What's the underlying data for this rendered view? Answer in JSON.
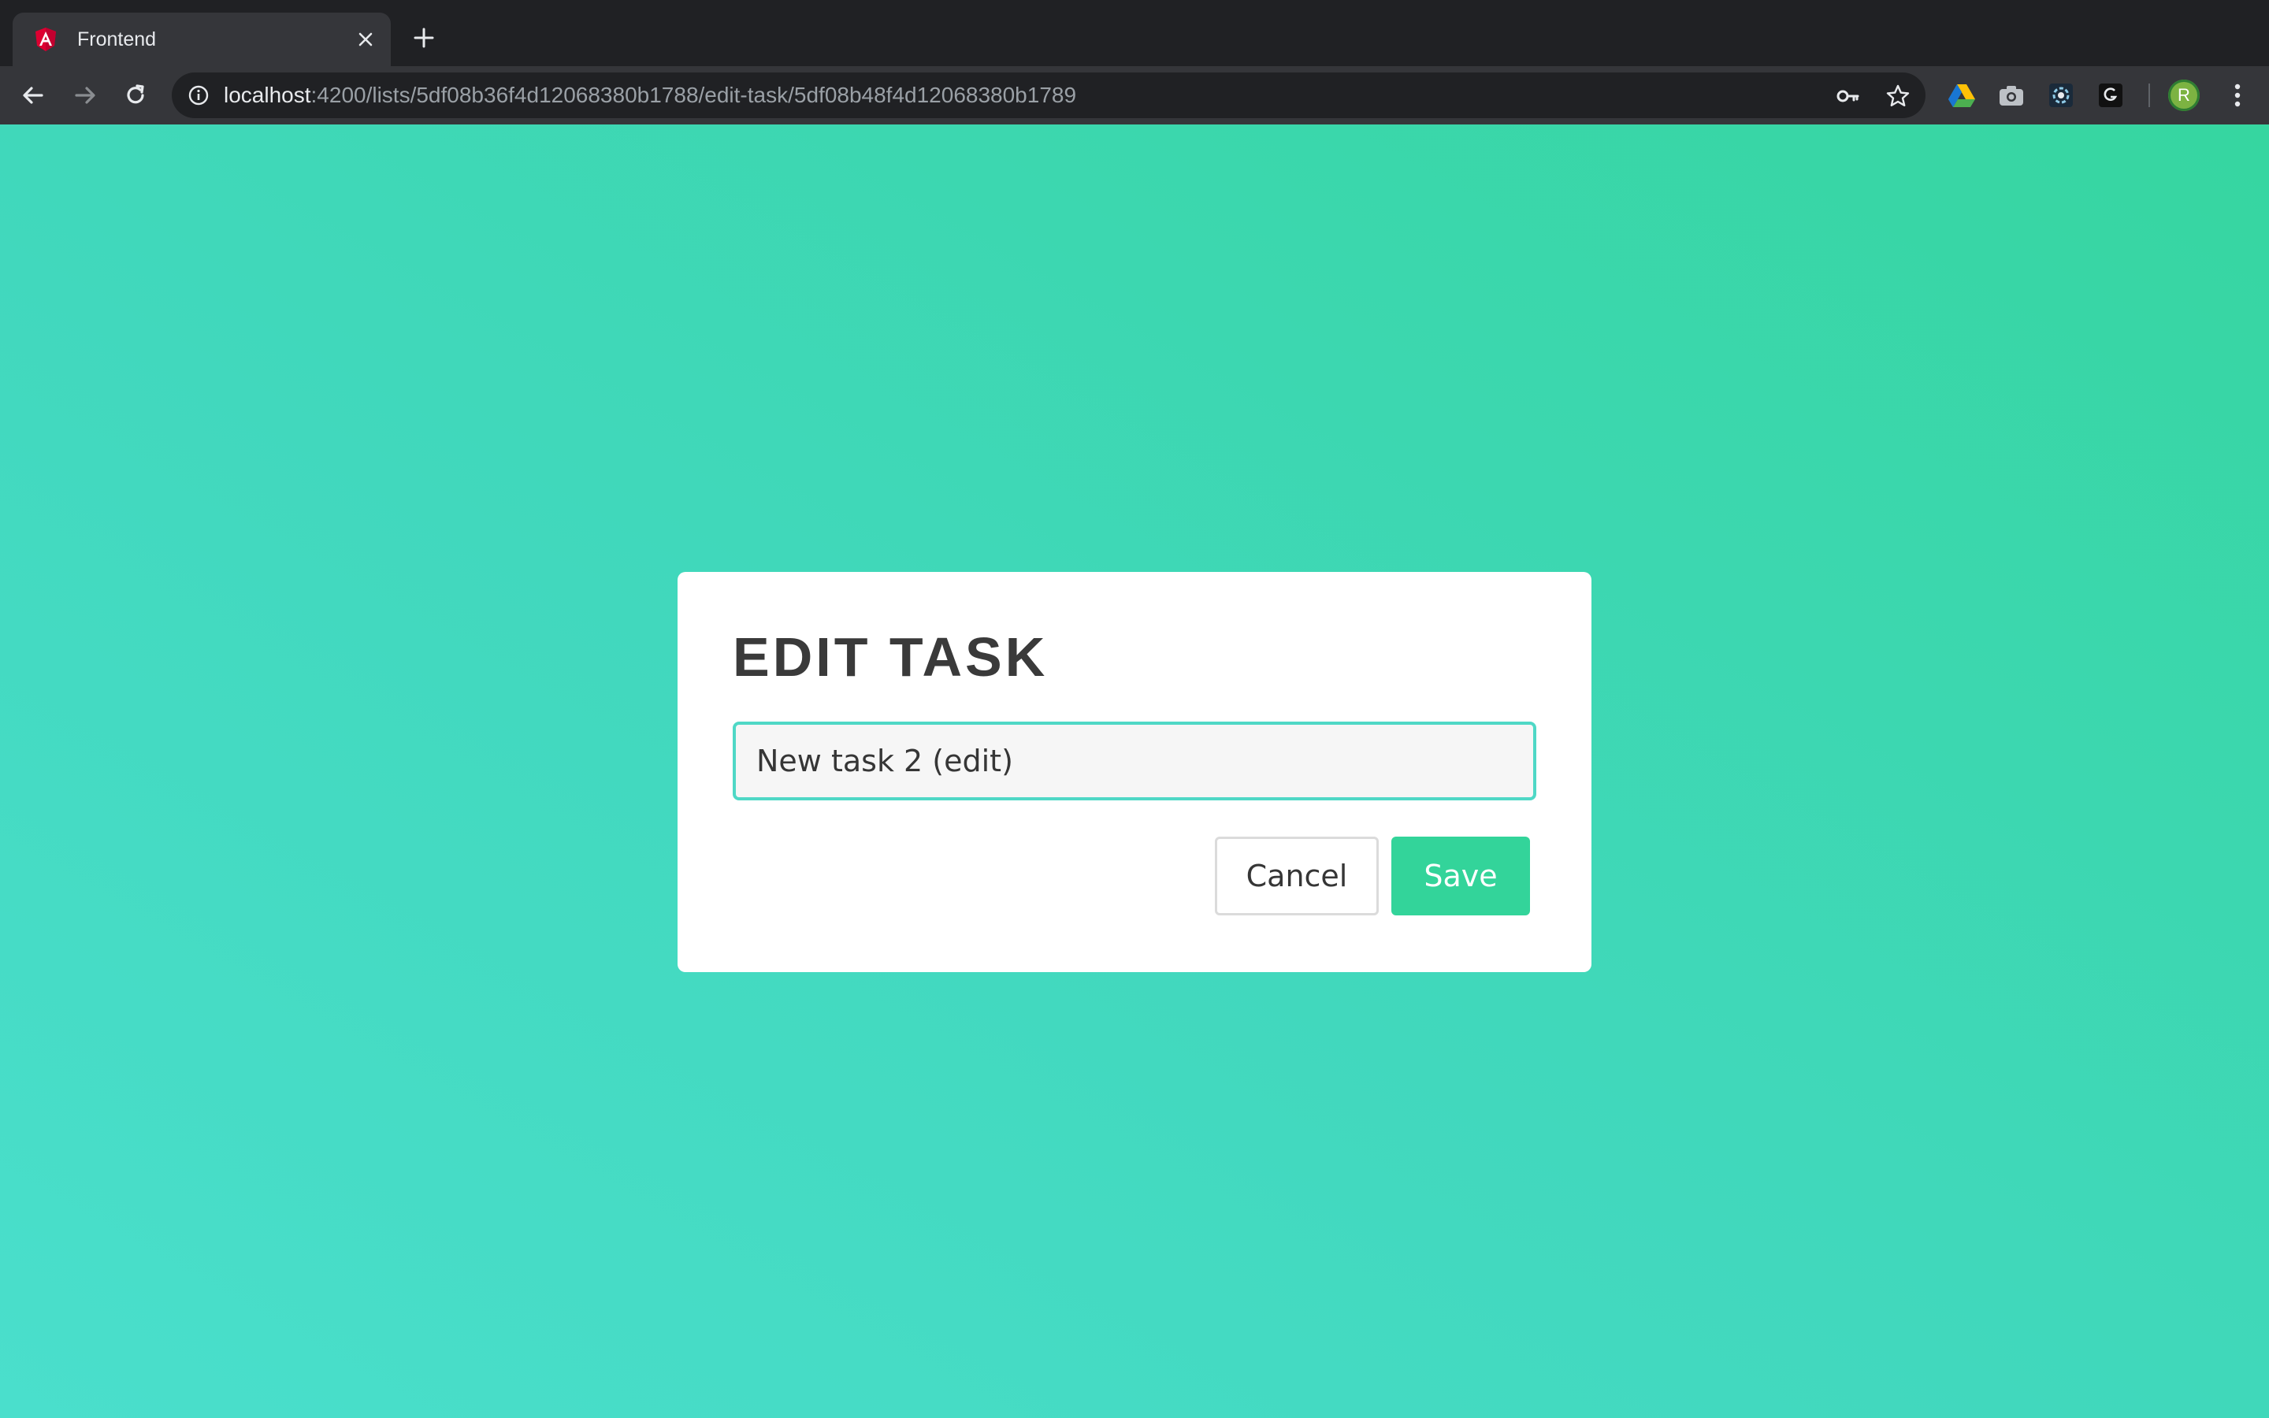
{
  "browser": {
    "tab": {
      "title": "Frontend",
      "favicon": "angular-icon"
    },
    "new_tab_icon": "plus-icon",
    "toolbar": {
      "back_icon": "arrow-left-icon",
      "forward_icon": "arrow-right-icon",
      "reload_icon": "reload-icon",
      "url_host": "localhost",
      "url_rest": ":4200/lists/5df08b36f4d12068380b1788/edit-task/5df08b48f4d12068380b1789",
      "extensions": [
        "google-drive-icon",
        "camera-icon",
        "extension-icon",
        "g-icon"
      ],
      "avatar_initial": "R"
    }
  },
  "page": {
    "background_colors": [
      "#4adfcc",
      "#36d6a0"
    ],
    "modal": {
      "title": "EDIT TASK",
      "input_value": "New task 2 (edit)",
      "cancel_label": "Cancel",
      "save_label": "Save",
      "accent": "#33d49a"
    }
  }
}
